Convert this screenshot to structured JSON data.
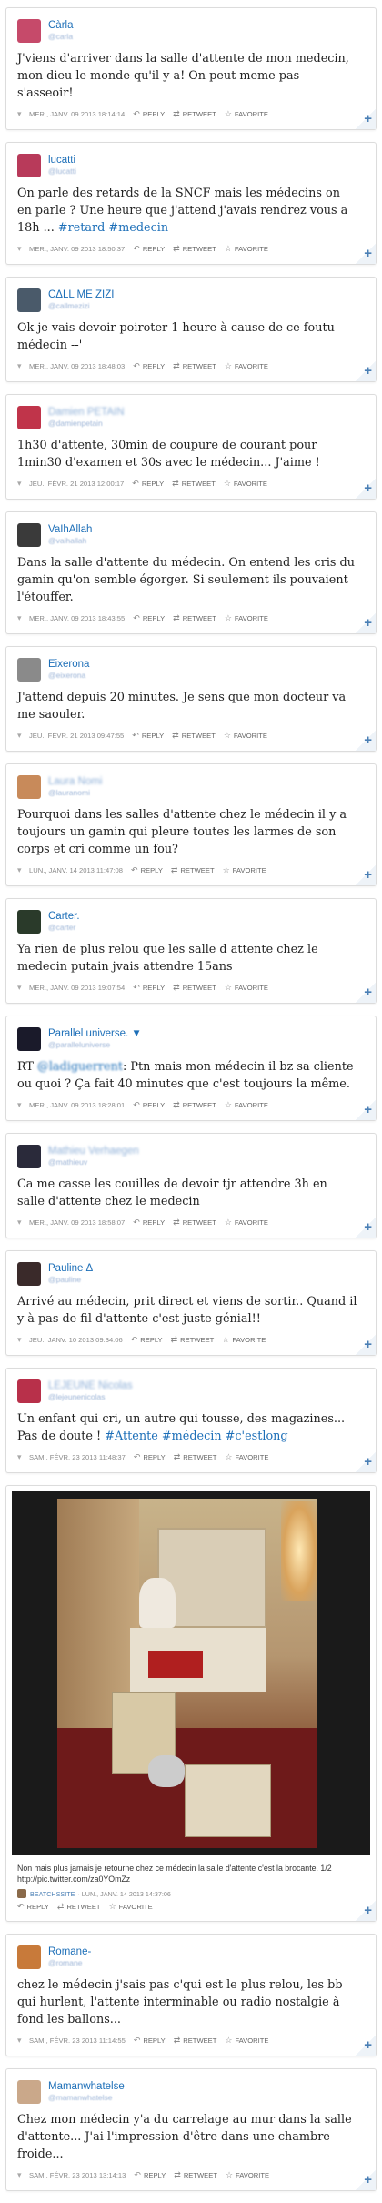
{
  "colors": {
    "link": "#1d6fb8",
    "meta": "#8a8a8a",
    "plus": "#4a7fb5"
  },
  "actions": {
    "reply": "REPLY",
    "retweet": "RETWEET",
    "favorite": "FAVORITE"
  },
  "tweets": [
    {
      "name": "Càrla",
      "handle": "@carla",
      "text": "J'viens d'arriver dans la salle d'attente de mon medecin, mon dieu le monde qu'il y a! On peut meme pas s'asseoir!",
      "link": "",
      "date": "MER., JANV. 09 2013 18:14:14",
      "avatar": "#c64a6a"
    },
    {
      "name": "lucatti",
      "handle": "@lucatti",
      "text": "On parle des retards de la SNCF mais les médecins on en parle ? Une heure que j'attend j'avais rendrez vous a 18h ...",
      "link": "#retard #medecin",
      "date": "MER., JANV. 09 2013 18:50:37",
      "avatar": "#b83a5a"
    },
    {
      "name": "CΔLL ME ZIZI",
      "handle": "@callmezizi",
      "text": "Ok je vais devoir poiroter 1 heure à cause de ce foutu médecin --'",
      "link": "",
      "date": "MER., JANV. 09 2013 18:48:03",
      "avatar": "#4a5a6a"
    },
    {
      "name": "Damien PETAIN",
      "handle": "@damienpetain",
      "text": "1h30 d'attente, 30min de coupure de courant pour 1min30 d'examen et 30s avec le médecin... J'aime !",
      "link": "",
      "date": "JEU., FÉVR. 21 2013 12:00:17",
      "avatar": "#c0344a"
    },
    {
      "name": "VaIhAllah",
      "handle": "@vaihallah",
      "text": "Dans la salle d'attente du médecin. On entend les cris du gamin qu'on semble égorger. Si seulement ils pouvaient l'étouffer.",
      "link": "",
      "date": "MER., JANV. 09 2013 18:43:55",
      "avatar": "#3a3a3a"
    },
    {
      "name": "Eixerona",
      "handle": "@eixerona",
      "text": "J'attend depuis 20 minutes. Je sens que mon docteur va me saouler.",
      "link": "",
      "date": "JEU., FÉVR. 21 2013 09:47:55",
      "avatar": "#8a8a8a"
    },
    {
      "name": "Laura Nomi",
      "handle": "@lauranomi",
      "text": "Pourquoi dans les salles d'attente chez le médecin il y a toujours un gamin qui pleure toutes les larmes de son corps et cri comme un fou?",
      "link": "",
      "date": "LUN., JANV. 14 2013 11:47:08",
      "avatar": "#c88a5a"
    },
    {
      "name": "Carter.",
      "handle": "@carter",
      "text": "Ya rien de plus relou que les salle d attente chez le medecin putain jvais attendre 15ans",
      "link": "",
      "date": "MER., JANV. 09 2013 19:07:54",
      "avatar": "#2a3a2a"
    },
    {
      "name": "Parallel universe. ▼",
      "handle": "@paralleluniverse",
      "text_prefix": "RT ",
      "mention": "@ladiguerrent",
      "text": ": Ptn mais mon médecin il bz sa cliente ou quoi ? Ça fait 40 minutes que c'est toujours la même.",
      "link": "",
      "date": "MER., JANV. 09 2013 18:28:01",
      "avatar": "#1a1a2a"
    },
    {
      "name": "Mathieu Verhaegen",
      "handle": "@mathieuv",
      "text": "Ca me casse les couilles de devoir tjr attendre 3h en salle d'attente chez le medecin",
      "link": "",
      "date": "MER., JANV. 09 2013 18:58:07",
      "avatar": "#2a2a3a"
    },
    {
      "name": "Pauline Δ",
      "handle": "@pauline",
      "text": "Arrivé au médecin, prit direct et viens de sortir.. Quand il y à pas de fil d'attente c'est juste génial!!",
      "link": "",
      "date": "JEU., JANV. 10 2013 09:34:06",
      "avatar": "#3a2a2a"
    },
    {
      "name": "LEJEUNE Nicolas",
      "handle": "@lejeunenicolas",
      "text": "Un enfant qui cri, un autre qui tousse, des magazines... Pas de doute !",
      "link": "#Attente #médecin #c'estlong",
      "date": "SAM., FÉVR. 23 2013 11:48:37",
      "avatar": "#b8304a"
    }
  ],
  "photo_tweet": {
    "caption": "Non mais plus jamais je retourne chez ce médecin la salle d'attente c'est la brocante. 1/2 http://pic.twitter.com/za0YOmZz",
    "user": "BEATCHSSITE",
    "date": "· LUN., JANV. 14 2013 14:37:06"
  },
  "tweets_after": [
    {
      "name": "Romane-",
      "handle": "@romane",
      "text": "chez le médecin j'sais pas c'qui est le plus relou, les bb qui hurlent, l'attente interminable ou radio nostalgie à fond les ballons...",
      "link": "",
      "date": "SAM., FÉVR. 23 2013 11:14:55",
      "avatar": "#c87a3a"
    },
    {
      "name": "Mamanwhatelse",
      "handle": "@mamanwhatelse",
      "text": "Chez mon médecin y'a du carrelage au mur dans la salle d'attente... J'ai l'impression d'être dans une chambre froide...",
      "link": "",
      "date": "SAM., FÉVR. 23 2013 13:14:13",
      "avatar": "#caa88a"
    }
  ]
}
